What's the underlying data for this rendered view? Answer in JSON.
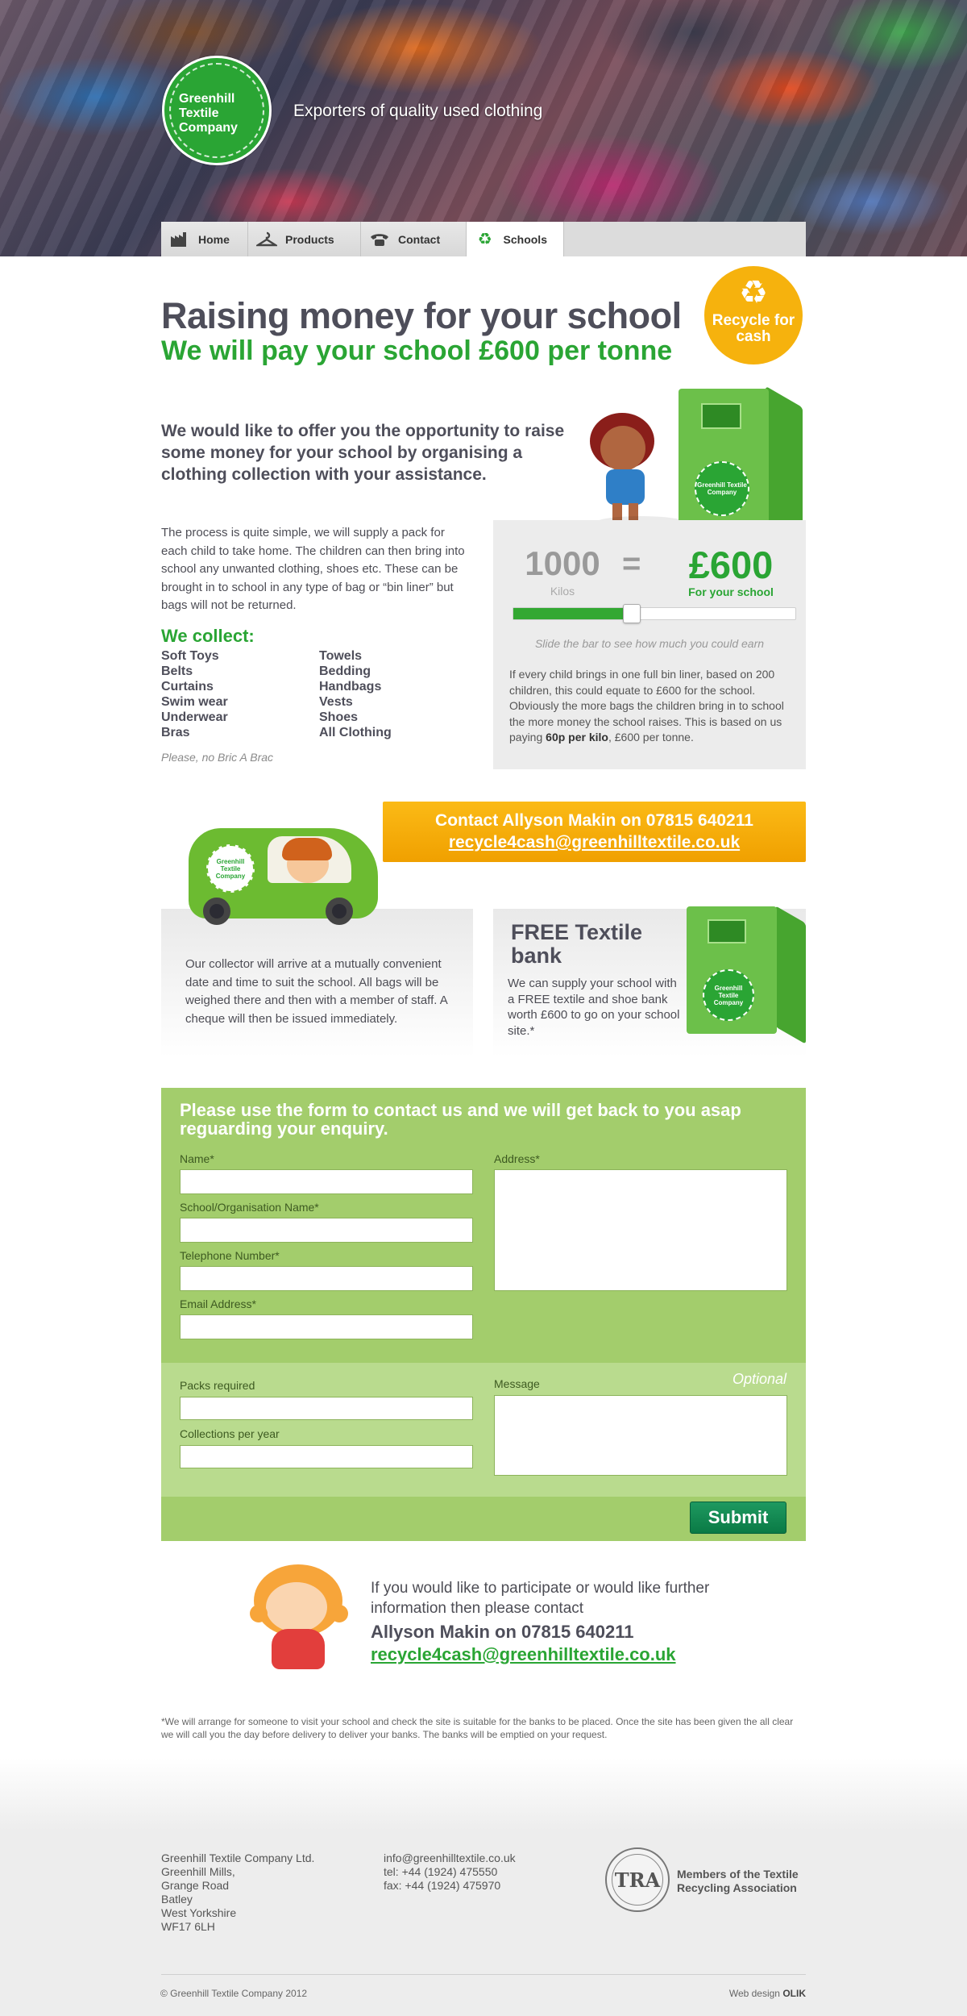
{
  "header": {
    "logo_text": "Greenhill Textile Company",
    "tagline": "Exporters of quality used clothing"
  },
  "nav": {
    "items": [
      {
        "label": "Home",
        "icon": "factory-icon"
      },
      {
        "label": "Products",
        "icon": "hanger-icon"
      },
      {
        "label": "Contact",
        "icon": "telephone-icon"
      },
      {
        "label": "Schools",
        "icon": "recycle-icon",
        "active": true
      }
    ]
  },
  "page": {
    "title": "Raising money for your school",
    "subtitle": "We will pay your school £600 per tonne",
    "badge": "Recycle for cash",
    "intro": "We would like to offer you the opportunity to raise some money for your school by organising a clothing collection with your assistance.",
    "body": "The process is quite simple, we will supply a pack for each child to take home. The children can then bring into school any unwanted clothing, shoes etc. These can be brought in to school in any type of bag or “bin liner” but bags will not be returned.",
    "collect_title": "We collect:",
    "collect_items": [
      "Soft Toys",
      "Towels",
      "Belts",
      "Bedding",
      "Curtains",
      "Handbags",
      "Swim wear",
      "Vests",
      "Underwear",
      "Shoes",
      "Bras",
      "All Clothing"
    ],
    "no_bric": "Please, no Bric A Brac"
  },
  "calculator": {
    "kilos": "1000",
    "kilos_label": "Kilos",
    "equals": "=",
    "amount": "£600",
    "amount_label": "For your school",
    "slider_value": 0.4,
    "hint": "Slide the bar to see how much you could earn",
    "note_pre": "If every child brings in one full bin liner, based on 200 children, this could equate to £600 for the school. Obviously the more bags the children bring in to school the more money the school raises. This is based on us paying ",
    "note_bold": "60p per kilo",
    "note_post": ", £600 per tonne."
  },
  "contact_banner": {
    "line1": "Contact Allyson Makin on 07815 640211",
    "email": "recycle4cash@greenhilltextile.co.uk"
  },
  "collector": {
    "text": "Our collector will arrive at a mutually convenient date and time to suit the school. All bags will be weighed there and then with a member of staff. A cheque will then be issued immediately."
  },
  "free_bank": {
    "title": "FREE Textile bank",
    "text": "We can supply your school with a FREE textile and shoe bank worth £600 to go on your school site.*"
  },
  "form": {
    "heading": "Please use the form to contact us and we will get back to you asap reguarding your enquiry.",
    "name_label": "Name*",
    "school_label": "School/Organisation Name*",
    "telephone_label": "Telephone Number*",
    "email_label": "Email Address*",
    "address_label": "Address*",
    "optional": "Optional",
    "packs_label": "Packs required",
    "collections_label": "Collections per year",
    "message_label": "Message",
    "submit": "Submit"
  },
  "bottom_contact": {
    "intro": "If you would like to participate or would like further information then please contact",
    "name": "Allyson Makin on 07815 640211",
    "email": "recycle4cash@greenhilltextile.co.uk"
  },
  "disclaimer": "*We will arrange for someone to visit your school and check the site is suitable for the banks to be placed. Once the site has been given the all clear we will call you the day before delivery to deliver your banks. The banks will be emptied on your request.",
  "footer": {
    "address": [
      "Greenhill Textile Company Ltd.",
      "Greenhill Mills,",
      "Grange Road",
      "Batley",
      "West Yorkshire",
      "WF17 6LH"
    ],
    "contact": [
      "info@greenhilltextile.co.uk",
      "tel: +44 (1924) 475550",
      "fax: +44 (1924) 475970"
    ],
    "tra_seal": "TRA",
    "tra_text": "Members of the Textile Recycling Association",
    "copyright": "© Greenhill Textile Company 2012",
    "webdesign_label": "Web design",
    "webdesign_brand": "OLIK"
  },
  "colors": {
    "brand_green": "#2aa534",
    "accent_orange": "#f6b20d",
    "form_green": "#a3cd6c",
    "submit_green": "#0a7a45"
  }
}
